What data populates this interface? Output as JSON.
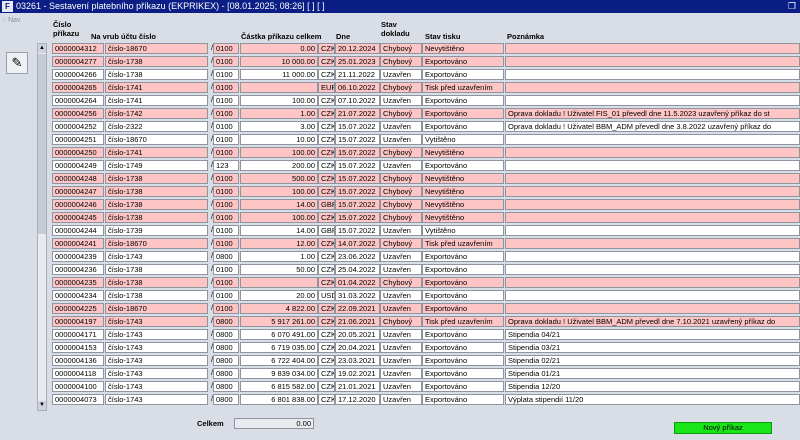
{
  "window": {
    "title": "03261 - Sestavení platebního příkazu (EKPRIKEX) - [08.01.2025; 08:26] [ ] [ ]",
    "restore_icon": "restore-icon"
  },
  "nav": {
    "label": "Nav"
  },
  "columns": {
    "cislo_prikazu": "Číslo\npříkazu",
    "na_vrub": "Na vrub účtu číslo",
    "castka": "Částka příkazu celkem",
    "dne": "Dne",
    "stav_dokladu": "Stav\ndokladu",
    "stav_tisku": "Stav tisku",
    "poznamka": "Poznámka"
  },
  "rows": [
    {
      "id": "0000004312",
      "acc": "číslo-18670",
      "bank": "0100",
      "amount": "0.00",
      "cur": "CZK",
      "date": "20.12.2024",
      "doc": "Chybový",
      "print": "Nevytištěno",
      "note": "",
      "pink": true
    },
    {
      "id": "0000004277",
      "acc": "číslo-1738",
      "bank": "0100",
      "amount": "10 000.00",
      "cur": "CZK",
      "date": "25.01.2023",
      "doc": "Chybový",
      "print": "Exportováno",
      "note": "",
      "pink": true
    },
    {
      "id": "0000004266",
      "acc": "číslo-1738",
      "bank": "0100",
      "amount": "11 000.00",
      "cur": "CZK",
      "date": "21.11.2022",
      "doc": "Uzavřen",
      "print": "Exportováno",
      "note": "",
      "pink": false
    },
    {
      "id": "0000004265",
      "acc": "číslo-1741",
      "bank": "0100",
      "amount": "",
      "cur": "EUR",
      "date": "06.10.2022",
      "doc": "Chybový",
      "print": "Tisk před uzavřením",
      "note": "",
      "pink": true
    },
    {
      "id": "0000004264",
      "acc": "číslo-1741",
      "bank": "0100",
      "amount": "100.00",
      "cur": "CZK",
      "date": "07.10.2022",
      "doc": "Uzavřen",
      "print": "Exportováno",
      "note": "",
      "pink": false
    },
    {
      "id": "0000004256",
      "acc": "číslo-1742",
      "bank": "0100",
      "amount": "1.00",
      "cur": "CZK",
      "date": "21.07.2022",
      "doc": "Chybový",
      "print": "Exportováno",
      "note": "Oprava dokladu ! Uživatel FIS_01 převedl dne 11.5.2023 uzavřený příkaz do st",
      "pink": true
    },
    {
      "id": "0000004252",
      "acc": "číslo-2322",
      "bank": "0100",
      "amount": "3.00",
      "cur": "CZK",
      "date": "15.07.2022",
      "doc": "Uzavřen",
      "print": "Exportováno",
      "note": "Oprava dokladu ! Uživatel BBM_ADM převedl dne 3.8.2022 uzavřený příkaz do",
      "pink": false
    },
    {
      "id": "0000004251",
      "acc": "číslo-18670",
      "bank": "0100",
      "amount": "10.00",
      "cur": "CZK",
      "date": "15.07.2022",
      "doc": "Uzavřen",
      "print": "Vytištěno",
      "note": "",
      "pink": false
    },
    {
      "id": "0000004250",
      "acc": "číslo-1741",
      "bank": "0100",
      "amount": "100.00",
      "cur": "CZK",
      "date": "15.07.2022",
      "doc": "Chybový",
      "print": "Nevytištěno",
      "note": "",
      "pink": true
    },
    {
      "id": "0000004249",
      "acc": "číslo-1749",
      "bank": "123",
      "amount": "200.00",
      "cur": "CZK",
      "date": "15.07.2022",
      "doc": "Uzavřen",
      "print": "Exportováno",
      "note": "",
      "pink": false
    },
    {
      "id": "0000004248",
      "acc": "číslo-1738",
      "bank": "0100",
      "amount": "500.00",
      "cur": "CZK",
      "date": "15.07.2022",
      "doc": "Chybový",
      "print": "Nevytištěno",
      "note": "",
      "pink": true
    },
    {
      "id": "0000004247",
      "acc": "číslo-1738",
      "bank": "0100",
      "amount": "100.00",
      "cur": "CZK",
      "date": "15.07.2022",
      "doc": "Chybový",
      "print": "Nevytištěno",
      "note": "",
      "pink": true
    },
    {
      "id": "0000004246",
      "acc": "číslo-1738",
      "bank": "0100",
      "amount": "14.00",
      "cur": "GBP",
      "date": "15.07.2022",
      "doc": "Chybový",
      "print": "Nevytištěno",
      "note": "",
      "pink": true
    },
    {
      "id": "0000004245",
      "acc": "číslo-1738",
      "bank": "0100",
      "amount": "100.00",
      "cur": "CZK",
      "date": "15.07.2022",
      "doc": "Chybový",
      "print": "Nevytištěno",
      "note": "",
      "pink": true
    },
    {
      "id": "0000004244",
      "acc": "číslo-1739",
      "bank": "0100",
      "amount": "14.00",
      "cur": "GBP",
      "date": "15.07.2022",
      "doc": "Uzavřen",
      "print": "Vytištěno",
      "note": "",
      "pink": false
    },
    {
      "id": "0000004241",
      "acc": "číslo-18670",
      "bank": "0100",
      "amount": "12.00",
      "cur": "CZK",
      "date": "14.07.2022",
      "doc": "Chybový",
      "print": "Tisk před uzavřením",
      "note": "",
      "pink": true
    },
    {
      "id": "0000004239",
      "acc": "číslo-1743",
      "bank": "0800",
      "amount": "1.00",
      "cur": "CZK",
      "date": "23.06.2022",
      "doc": "Uzavřen",
      "print": "Exportováno",
      "note": "",
      "pink": false
    },
    {
      "id": "0000004236",
      "acc": "číslo-1738",
      "bank": "0100",
      "amount": "50.00",
      "cur": "CZK",
      "date": "25.04.2022",
      "doc": "Uzavřen",
      "print": "Exportováno",
      "note": "",
      "pink": false
    },
    {
      "id": "0000004235",
      "acc": "číslo-1738",
      "bank": "0100",
      "amount": "",
      "cur": "CZK",
      "date": "01.04.2022",
      "doc": "Chybový",
      "print": "Exportováno",
      "note": "",
      "pink": true
    },
    {
      "id": "0000004234",
      "acc": "číslo-1738",
      "bank": "0100",
      "amount": "20.00",
      "cur": "USD",
      "date": "31.03.2022",
      "doc": "Uzavřen",
      "print": "Exportováno",
      "note": "",
      "pink": false
    },
    {
      "id": "0000004225",
      "acc": "číslo-18670",
      "bank": "0100",
      "amount": "4 822.00",
      "cur": "CZK",
      "date": "22.09.2021",
      "doc": "Uzavřen",
      "print": "Exportováno",
      "note": "",
      "pink": true
    },
    {
      "id": "0000004197",
      "acc": "číslo-1743",
      "bank": "0800",
      "amount": "5 917 261.00",
      "cur": "CZK",
      "date": "21.06.2021",
      "doc": "Chybový",
      "print": "Tisk před uzavřením",
      "note": "Oprava dokladu ! Uživatel BBM_ADM převedl dne 7.10.2021 uzavřený příkaz do",
      "pink": true
    },
    {
      "id": "0000004171",
      "acc": "číslo-1743",
      "bank": "0800",
      "amount": "6 070 491.00",
      "cur": "CZK",
      "date": "20.05.2021",
      "doc": "Uzavřen",
      "print": "Exportováno",
      "note": "Stipendia 04/21",
      "pink": false
    },
    {
      "id": "0000004153",
      "acc": "číslo-1743",
      "bank": "0800",
      "amount": "6 719 035.00",
      "cur": "CZK",
      "date": "20.04.2021",
      "doc": "Uzavřen",
      "print": "Exportováno",
      "note": "Stipendia 03/21",
      "pink": false
    },
    {
      "id": "0000004136",
      "acc": "číslo-1743",
      "bank": "0800",
      "amount": "6 722 404.00",
      "cur": "CZK",
      "date": "23.03.2021",
      "doc": "Uzavřen",
      "print": "Exportováno",
      "note": "Stipendia 02/21",
      "pink": false
    },
    {
      "id": "0000004118",
      "acc": "číslo-1743",
      "bank": "0800",
      "amount": "9 839 034.00",
      "cur": "CZK",
      "date": "19.02.2021",
      "doc": "Uzavřen",
      "print": "Exportováno",
      "note": "Stipendia 01/21",
      "pink": false
    },
    {
      "id": "0000004100",
      "acc": "číslo-1743",
      "bank": "0800",
      "amount": "6 815 582.00",
      "cur": "CZK",
      "date": "21.01.2021",
      "doc": "Uzavřen",
      "print": "Exportováno",
      "note": "Stipendia 12/20",
      "pink": false
    },
    {
      "id": "0000004073",
      "acc": "číslo-1743",
      "bank": "0800",
      "amount": "6 801 838.00",
      "cur": "CZK",
      "date": "17.12.2020",
      "doc": "Uzavřen",
      "print": "Exportováno",
      "note": "Výplata stipendií 11/20",
      "pink": false
    }
  ],
  "totals": {
    "label": "Celkem",
    "value": "0.00"
  },
  "actions": {
    "new_order": "Nový příkaz"
  },
  "colors": {
    "error_row": "#ffc4c4",
    "new_button": "#19e619",
    "titlebar": "#0b1e86"
  }
}
